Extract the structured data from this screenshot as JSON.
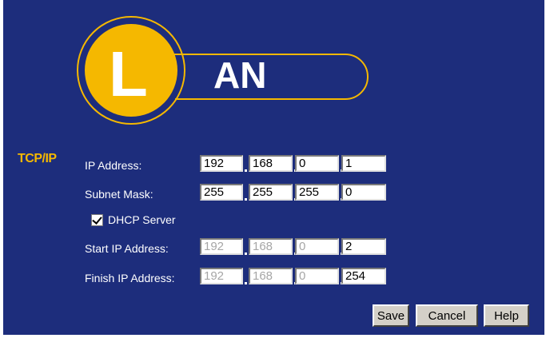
{
  "logo": {
    "letter": "L",
    "word": "AN"
  },
  "section": {
    "label": "TCP/IP"
  },
  "ip_address": {
    "label": "IP Address:",
    "octets": [
      "192",
      "168",
      "0",
      "1"
    ]
  },
  "subnet_mask": {
    "label": "Subnet Mask:",
    "octets": [
      "255",
      "255",
      "255",
      "0"
    ]
  },
  "dhcp": {
    "label": "DHCP Server",
    "checked": true
  },
  "start_ip": {
    "label": "Start IP Address:",
    "octets": [
      "192",
      "168",
      "0",
      "2"
    ],
    "editable": [
      false,
      false,
      false,
      true
    ]
  },
  "finish_ip": {
    "label": "Finish IP Address:",
    "octets": [
      "192",
      "168",
      "0",
      "254"
    ],
    "editable": [
      false,
      false,
      false,
      true
    ]
  },
  "buttons": {
    "save": "Save",
    "cancel": "Cancel",
    "help": "Help"
  },
  "colors": {
    "panel": "#1d2d7c",
    "accent": "#f5b800",
    "text": "#ffffff"
  }
}
